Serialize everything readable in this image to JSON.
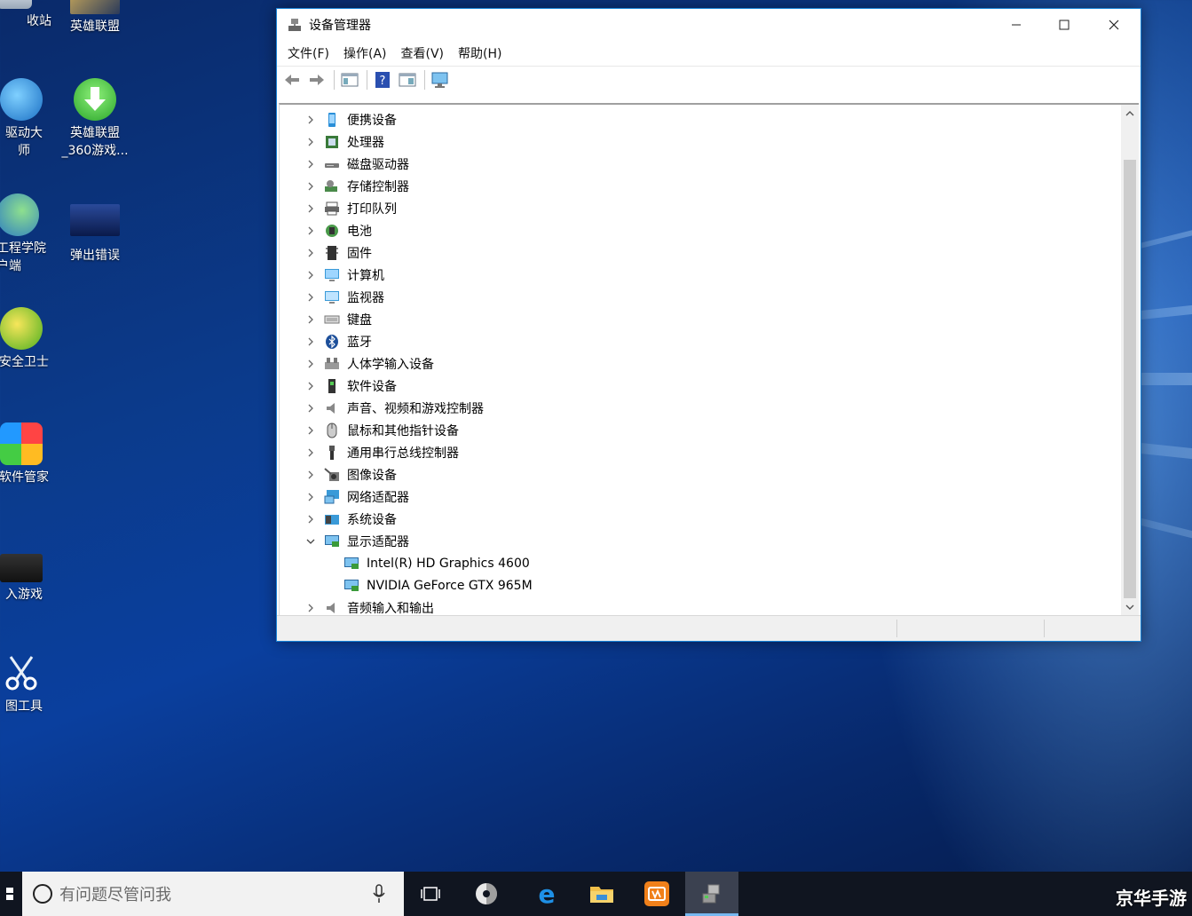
{
  "desktop": {
    "icons": [
      {
        "label": "回收站",
        "visible": "收站"
      },
      {
        "label": "英雄联盟"
      },
      {
        "label": "驱动大师",
        "visible": "驱动大师"
      },
      {
        "label": "英雄联盟_360游戏..."
      },
      {
        "label": "工程学院客户端"
      },
      {
        "label": "弹出错误"
      },
      {
        "label": "安全卫士"
      },
      {
        "label": "软件管家"
      },
      {
        "label": "入游戏"
      },
      {
        "label": "图工具"
      }
    ]
  },
  "desktop_labels": {
    "i0": "收站",
    "i1": "英雄联盟",
    "i2": "驱动大师",
    "i3a": "英雄联盟",
    "i3b": "_360游戏...",
    "i4a": "工程学院",
    "i4b": "客户端",
    "i5": "弹出错误",
    "i6": "安全卫士",
    "i7": "软件管家",
    "i8": "入游戏",
    "i9": "图工具"
  },
  "window": {
    "title": "设备管理器",
    "menu": [
      "文件(F)",
      "操作(A)",
      "查看(V)",
      "帮助(H)"
    ],
    "tree": [
      {
        "label": "便携设备",
        "icon": "portable-device-icon",
        "expanded": false
      },
      {
        "label": "处理器",
        "icon": "processor-icon",
        "expanded": false
      },
      {
        "label": "磁盘驱动器",
        "icon": "disk-drive-icon",
        "expanded": false
      },
      {
        "label": "存储控制器",
        "icon": "storage-controller-icon",
        "expanded": false
      },
      {
        "label": "打印队列",
        "icon": "printer-icon",
        "expanded": false
      },
      {
        "label": "电池",
        "icon": "battery-icon",
        "expanded": false
      },
      {
        "label": "固件",
        "icon": "firmware-icon",
        "expanded": false
      },
      {
        "label": "计算机",
        "icon": "computer-icon",
        "expanded": false
      },
      {
        "label": "监视器",
        "icon": "monitor-icon",
        "expanded": false
      },
      {
        "label": "键盘",
        "icon": "keyboard-icon",
        "expanded": false
      },
      {
        "label": "蓝牙",
        "icon": "bluetooth-icon",
        "expanded": false
      },
      {
        "label": "人体学输入设备",
        "icon": "hid-icon",
        "expanded": false
      },
      {
        "label": "软件设备",
        "icon": "software-device-icon",
        "expanded": false
      },
      {
        "label": "声音、视频和游戏控制器",
        "icon": "sound-icon",
        "expanded": false
      },
      {
        "label": "鼠标和其他指针设备",
        "icon": "mouse-icon",
        "expanded": false
      },
      {
        "label": "通用串行总线控制器",
        "icon": "usb-icon",
        "expanded": false
      },
      {
        "label": "图像设备",
        "icon": "imaging-device-icon",
        "expanded": false
      },
      {
        "label": "网络适配器",
        "icon": "network-adapter-icon",
        "expanded": false
      },
      {
        "label": "系统设备",
        "icon": "system-device-icon",
        "expanded": false
      },
      {
        "label": "显示适配器",
        "icon": "display-adapter-icon",
        "expanded": true
      },
      {
        "label": "Intel(R) HD Graphics 4600",
        "icon": "display-adapter-icon",
        "child": true
      },
      {
        "label": "NVIDIA GeForce GTX 965M",
        "icon": "display-adapter-icon",
        "child": true
      },
      {
        "label": "音频输入和输出",
        "icon": "audio-io-icon",
        "expanded": false
      }
    ]
  },
  "taskbar": {
    "search_placeholder": "有问题尽管问我",
    "watermark": "京华手游"
  },
  "colors": {
    "accent": "#1883d7",
    "taskbar": "#101520"
  }
}
